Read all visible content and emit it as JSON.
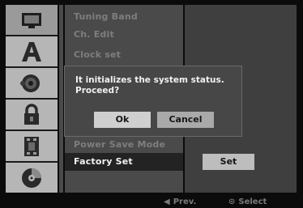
{
  "menu": {
    "items": [
      {
        "label": "Tuning Band",
        "state": "dim"
      },
      {
        "label": "Ch. Edit",
        "state": "dim"
      },
      {
        "label": "Clock set",
        "state": "dim"
      },
      {
        "label": "Power Save Mode",
        "state": "dim"
      },
      {
        "label": "Factory Set",
        "state": "selected"
      }
    ]
  },
  "rail": {
    "icons": [
      {
        "name": "display-icon",
        "active": true
      },
      {
        "name": "language-icon",
        "active": false
      },
      {
        "name": "audio-icon",
        "active": false
      },
      {
        "name": "lock-icon",
        "active": false
      },
      {
        "name": "recording-icon",
        "active": false
      },
      {
        "name": "disc-icon",
        "active": false
      }
    ]
  },
  "panel": {
    "set_label": "Set"
  },
  "dialog": {
    "message": "It initializes the system status.\nProceed?",
    "ok_label": "Ok",
    "cancel_label": "Cancel"
  },
  "statusbar": {
    "prev_glyph": "◀",
    "prev_label": "Prev.",
    "select_glyph": "⊙",
    "select_label": "Select"
  },
  "colors": {
    "background": "#0b0b0b",
    "menu_bg": "#4a4a4a",
    "selected_bg": "#232323",
    "rail_active": "#9a9a9a",
    "rail_inactive": "#b6b6b6"
  }
}
